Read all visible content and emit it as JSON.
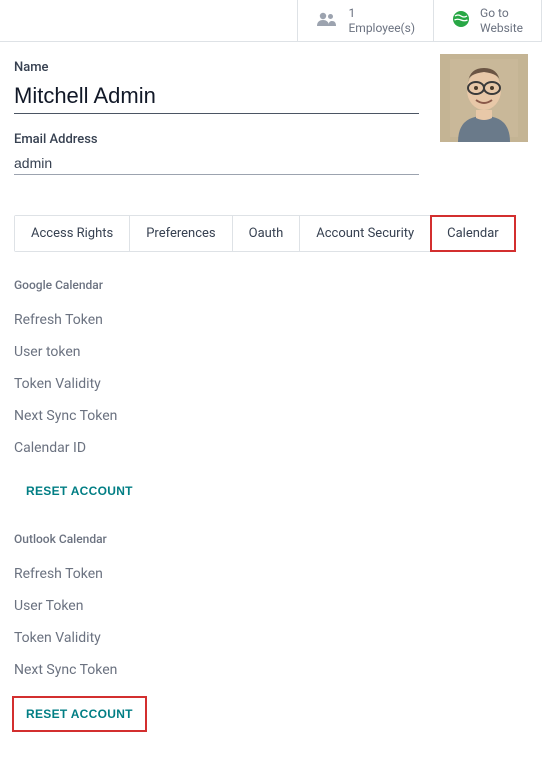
{
  "stats": {
    "employees": {
      "count": "1",
      "label": "Employee(s)"
    },
    "website": {
      "line1": "Go to",
      "line2": "Website"
    }
  },
  "form": {
    "name_label": "Name",
    "name_value": "Mitchell Admin",
    "email_label": "Email Address",
    "email_value": "admin"
  },
  "tabs": [
    {
      "label": "Access Rights"
    },
    {
      "label": "Preferences"
    },
    {
      "label": "Oauth"
    },
    {
      "label": "Account Security"
    },
    {
      "label": "Calendar"
    }
  ],
  "google": {
    "title": "Google Calendar",
    "fields": [
      "Refresh Token",
      "User token",
      "Token Validity",
      "Next Sync Token",
      "Calendar ID"
    ],
    "reset_label": "RESET ACCOUNT"
  },
  "outlook": {
    "title": "Outlook Calendar",
    "fields": [
      "Refresh Token",
      "User Token",
      "Token Validity",
      "Next Sync Token"
    ],
    "reset_label": "RESET ACCOUNT"
  }
}
